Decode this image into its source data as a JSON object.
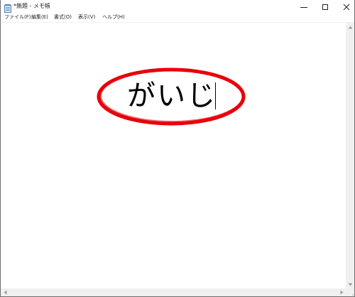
{
  "window": {
    "title": "*無題 - メモ帳"
  },
  "menubar": {
    "items": [
      {
        "label": "ファイル(F)"
      },
      {
        "label": "編集(E)"
      },
      {
        "label": "書式(O)"
      },
      {
        "label": "表示(V)"
      },
      {
        "label": "ヘルプ(H)"
      }
    ]
  },
  "editor": {
    "text": "がいじ"
  },
  "colors": {
    "highlight_ellipse": "#e8000b",
    "titlebar_bg": "#ffffff",
    "scrollbar_bg": "#f0f0f0"
  },
  "icons": {
    "app": "notepad-icon",
    "minimize": "minimize-icon",
    "maximize": "maximize-icon",
    "close": "close-icon"
  }
}
